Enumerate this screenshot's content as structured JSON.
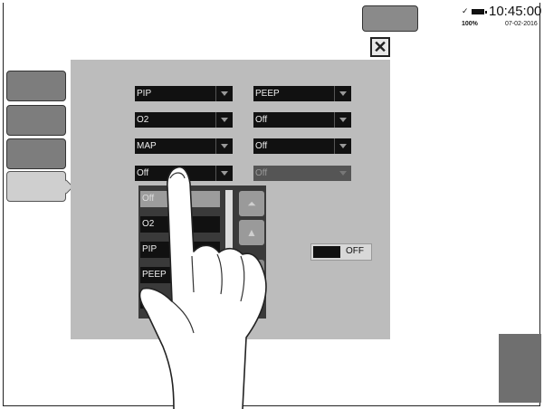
{
  "status": {
    "time": "10:45:00",
    "battery_percent": "100%",
    "date": "07-02-2016",
    "icons": [
      "plug-icon",
      "battery-icon"
    ]
  },
  "close_symbol": "✕",
  "dropdowns": [
    {
      "value": "PIP"
    },
    {
      "value": "PEEP"
    },
    {
      "value": "O2"
    },
    {
      "value": "Off"
    },
    {
      "value": "MAP"
    },
    {
      "value": "Off"
    },
    {
      "value": "Off"
    },
    {
      "value": "Off"
    }
  ],
  "list": {
    "options": [
      "Off",
      "O2",
      "PIP",
      "PEEP",
      "P"
    ],
    "selected": "Off",
    "scroll_up_top": "⏶",
    "scroll_up": "▲"
  },
  "toggle": {
    "label": "OFF"
  }
}
